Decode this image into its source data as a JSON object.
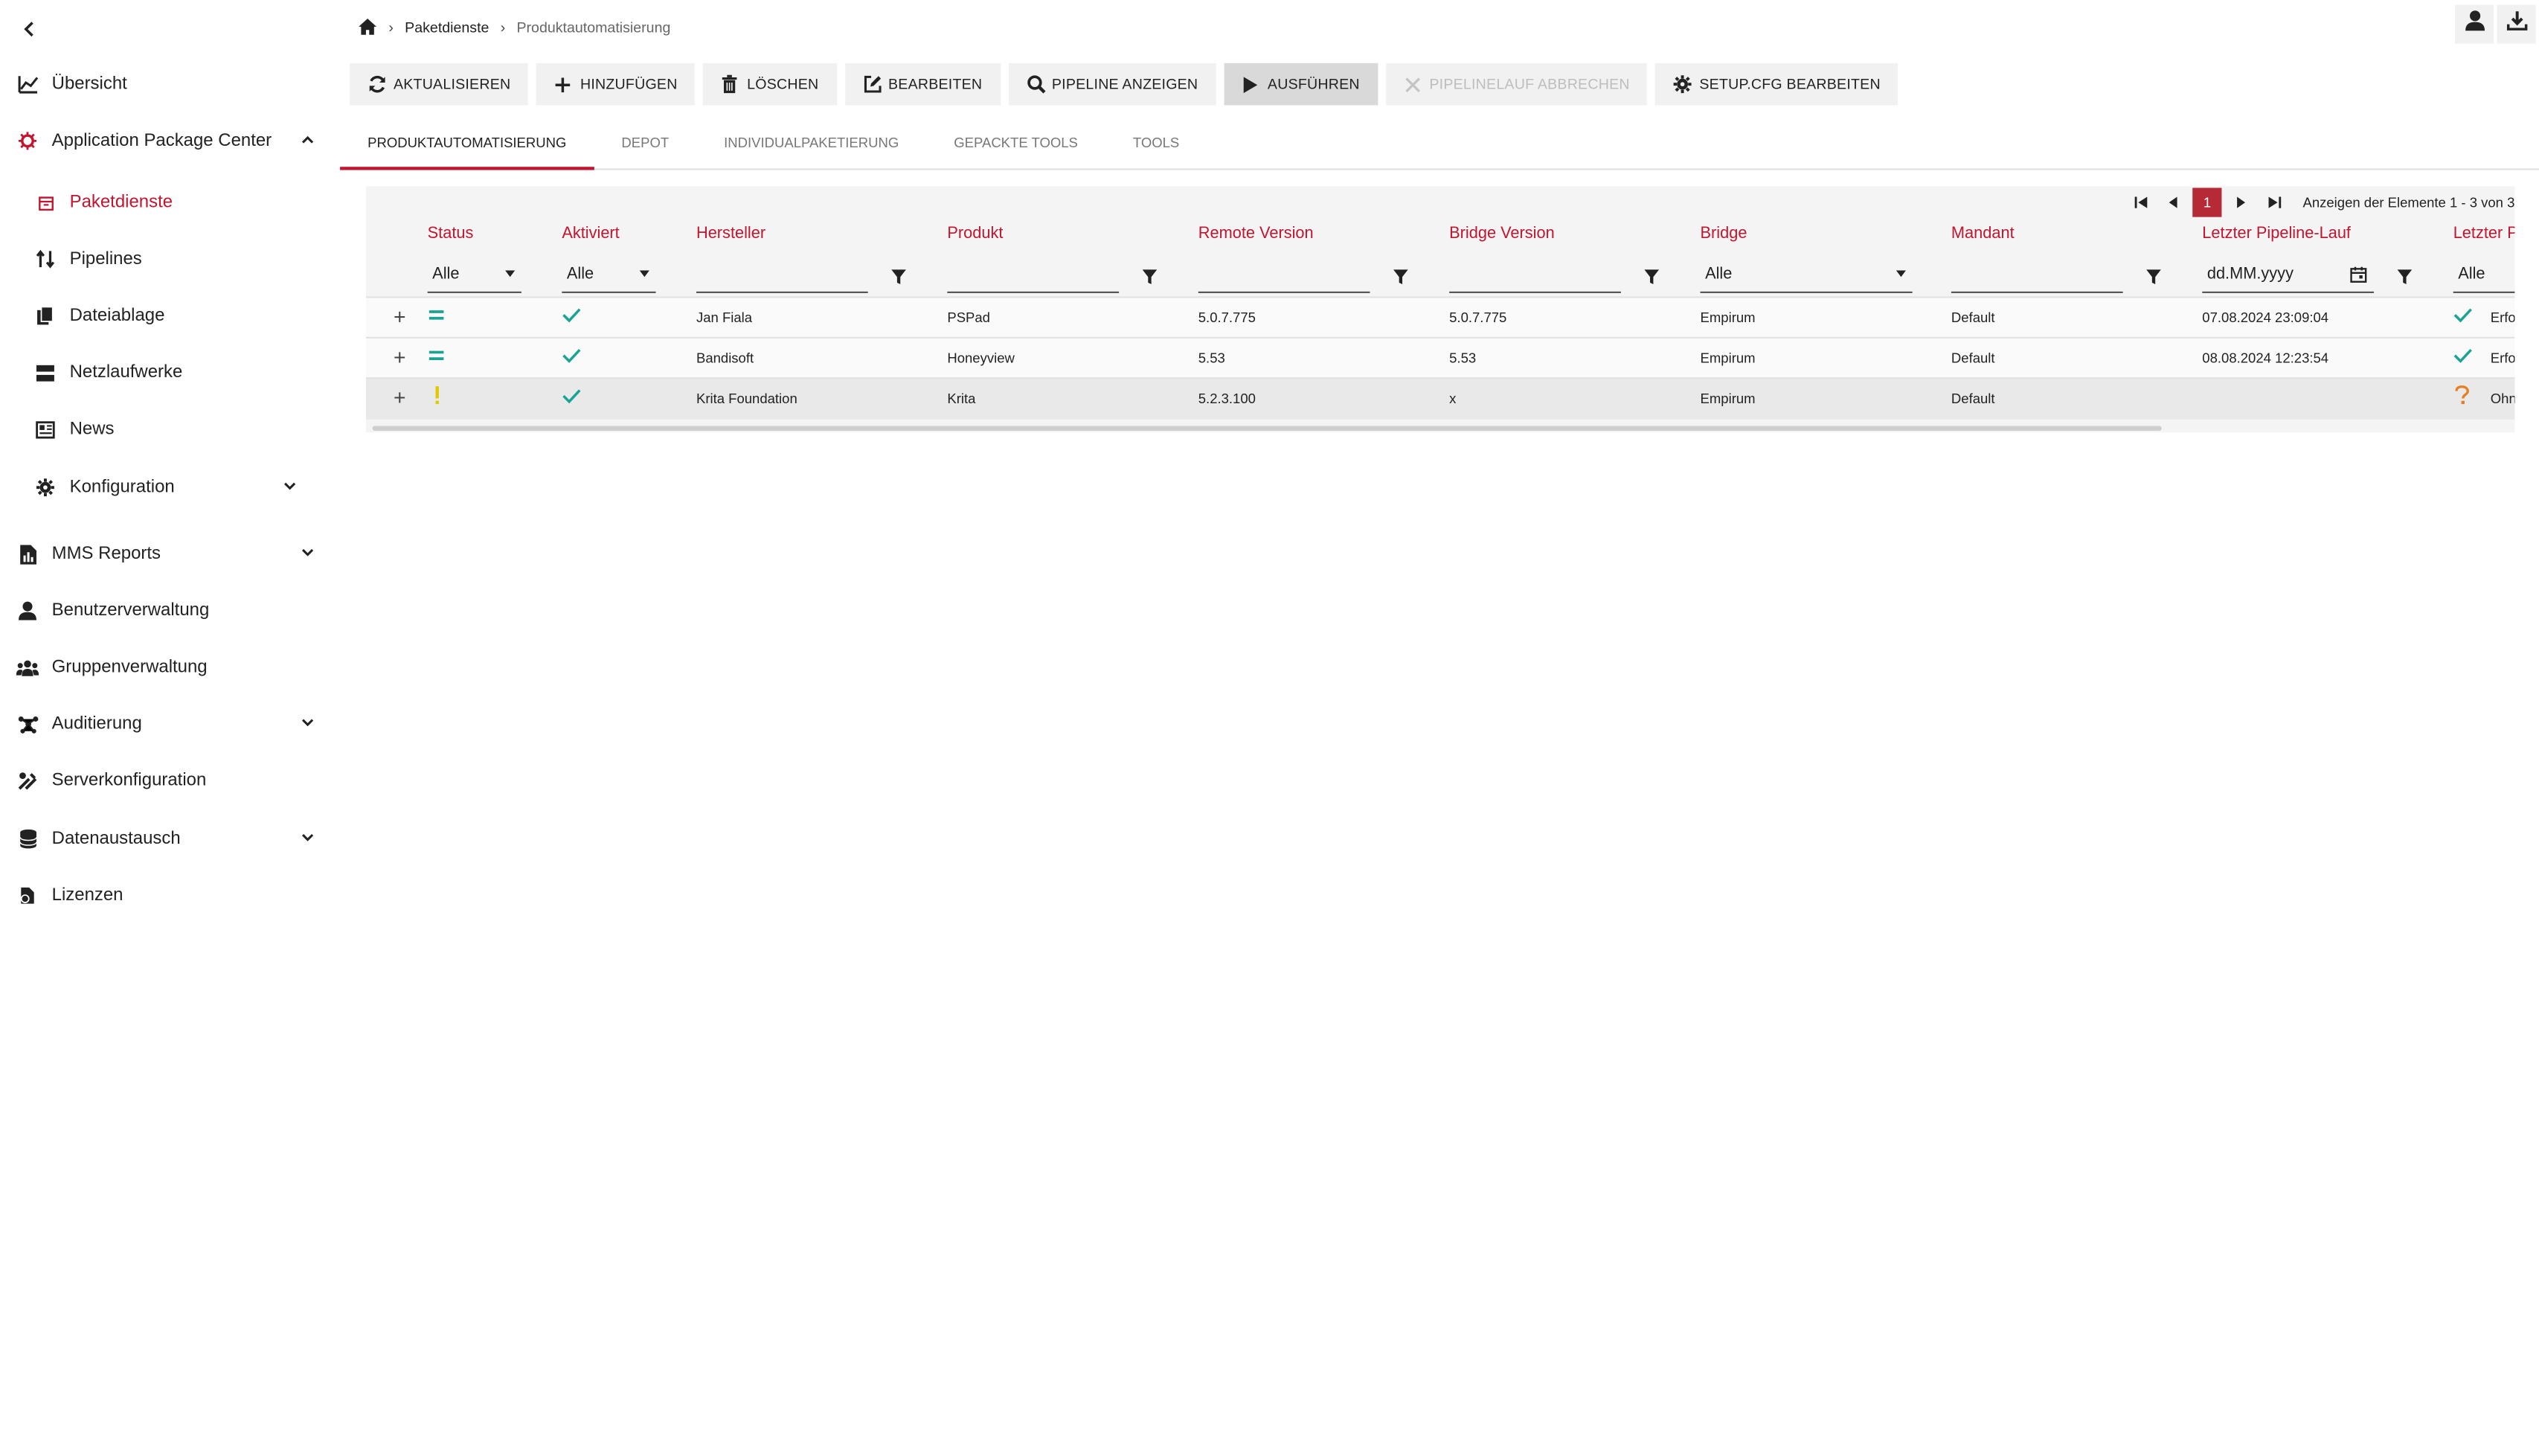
{
  "breadcrumb": {
    "level1": "Paketdienste",
    "level2": "Produktautomatisierung"
  },
  "sidebar": {
    "items": [
      {
        "label": "Übersicht"
      },
      {
        "label": "Application Package Center"
      },
      {
        "label": "Paketdienste"
      },
      {
        "label": "Pipelines"
      },
      {
        "label": "Dateiablage"
      },
      {
        "label": "Netzlaufwerke"
      },
      {
        "label": "News"
      },
      {
        "label": "Konfiguration"
      },
      {
        "label": "MMS Reports"
      },
      {
        "label": "Benutzerverwaltung"
      },
      {
        "label": "Gruppenverwaltung"
      },
      {
        "label": "Auditierung"
      },
      {
        "label": "Serverkonfiguration"
      },
      {
        "label": "Datenaustausch"
      },
      {
        "label": "Lizenzen"
      }
    ]
  },
  "toolbar": {
    "refresh": "AKTUALISIEREN",
    "add": "HINZUFÜGEN",
    "delete": "LÖSCHEN",
    "edit": "BEARBEITEN",
    "show_pipeline": "PIPELINE ANZEIGEN",
    "run": "AUSFÜHREN",
    "abort": "PIPELINELAUF ABBRECHEN",
    "setup": "SETUP.CFG BEARBEITEN"
  },
  "tabs": [
    "PRODUKTAUTOMATISIERUNG",
    "DEPOT",
    "INDIVIDUALPAKETIERUNG",
    "GEPACKTE TOOLS",
    "TOOLS"
  ],
  "pager": {
    "page": "1",
    "info": "Anzeigen der Elemente 1 - 3 von 3"
  },
  "columns": {
    "status": "Status",
    "aktiviert": "Aktiviert",
    "hersteller": "Hersteller",
    "produkt": "Produkt",
    "remote": "Remote Version",
    "bridge_version": "Bridge Version",
    "bridge": "Bridge",
    "mandant": "Mandant",
    "letzter_lauf": "Letzter Pipeline-Lauf",
    "letzter_p": "Letzter P"
  },
  "filters": {
    "status": "Alle",
    "aktiviert": "Alle",
    "bridge": "Alle",
    "date_placeholder": "dd.MM.yyyy",
    "letzter_p": "Alle"
  },
  "rows": [
    {
      "status_icon": "equals-icon",
      "hersteller": "Jan Fiala",
      "produkt": "PSPad",
      "remote": "5.0.7.775",
      "bridge_version": "5.0.7.775",
      "bridge": "Empirum",
      "mandant": "Default",
      "letzter_lauf": "07.08.2024 23:09:04",
      "result_icon": "check-icon",
      "result": "Erfo"
    },
    {
      "status_icon": "equals-icon",
      "hersteller": "Bandisoft",
      "produkt": "Honeyview",
      "remote": "5.53",
      "bridge_version": "5.53",
      "bridge": "Empirum",
      "mandant": "Default",
      "letzter_lauf": "08.08.2024 12:23:54",
      "result_icon": "check-icon",
      "result": "Erfo"
    },
    {
      "status_icon": "exclamation-icon",
      "hersteller": "Krita Foundation",
      "produkt": "Krita",
      "remote": "5.2.3.100",
      "bridge_version": "x",
      "bridge": "Empirum",
      "mandant": "Default",
      "letzter_lauf": "",
      "result_icon": "question-icon",
      "result": "Ohn"
    }
  ],
  "colors": {
    "accent": "#c2152f",
    "check": "#1aa394",
    "warning": "#e2c800",
    "question": "#e67e22"
  }
}
